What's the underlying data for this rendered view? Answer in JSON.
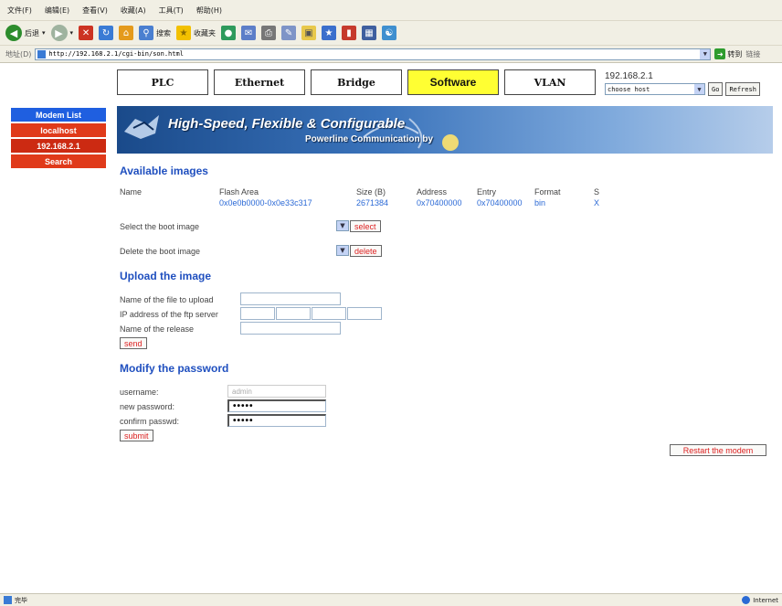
{
  "browser": {
    "menu": [
      "文件(F)",
      "编辑(E)",
      "查看(V)",
      "收藏(A)",
      "工具(T)",
      "帮助(H)"
    ],
    "back_label": "后退",
    "search_label": "搜索",
    "favorites_label": "收藏夹",
    "address_label": "地址(D)",
    "url": "http://192.168.2.1/cgi-bin/son.html",
    "go_label": "转到",
    "links_label": "链接",
    "status_text": "完毕",
    "zone_text": "Internet"
  },
  "tabs": [
    {
      "label": "PLC",
      "active": false
    },
    {
      "label": "Ethernet",
      "active": false
    },
    {
      "label": "Bridge",
      "active": false
    },
    {
      "label": "Software",
      "active": true
    },
    {
      "label": "VLAN",
      "active": false
    }
  ],
  "host": {
    "ip": "192.168.2.1",
    "select_value": "choose host",
    "go_label": "Go",
    "refresh_label": "Refresh"
  },
  "sidebar": {
    "items": [
      {
        "label": "Modem List",
        "color": "#1f5fe0"
      },
      {
        "label": "localhost",
        "color": "#e03a1a"
      },
      {
        "label": "192.168.2.1",
        "color": "#cc2a12"
      },
      {
        "label": "Search",
        "color": "#e03a1a"
      }
    ]
  },
  "banner": {
    "title": "High-Speed, Flexible & Configurable",
    "subtitle": "Powerline Communication by"
  },
  "images": {
    "title": "Available images",
    "headers": {
      "name": "Name",
      "flash": "Flash Area",
      "size": "Size (B)",
      "address": "Address",
      "entry": "Entry",
      "format": "Format",
      "s": "S"
    },
    "row": {
      "flash": "0x0e0b0000-0x0e33c317",
      "size": "2671384",
      "address": "0x70400000",
      "entry": "0x70400000",
      "format": "bin",
      "s": "X"
    },
    "select_label": "Select the boot image",
    "select_button": "select",
    "delete_label": "Delete the boot image",
    "delete_button": "delete"
  },
  "upload": {
    "title": "Upload the image",
    "file_label": "Name of the file to upload",
    "ftp_label": "IP address of the ftp server",
    "release_label": "Name of the release",
    "send_button": "send"
  },
  "password": {
    "title": "Modify the password",
    "username_label": "username:",
    "username_value": "admin",
    "new_label": "new password:",
    "new_value": "•••••",
    "confirm_label": "confirm passwd:",
    "confirm_value": "•••••",
    "submit_button": "submit"
  },
  "restart_button": "Restart the modem",
  "colors": {
    "accent_blue": "#1f4fbf",
    "value_blue": "#2c6ad6",
    "tab_active": "#ffff33",
    "button_red": "#dd2222"
  }
}
